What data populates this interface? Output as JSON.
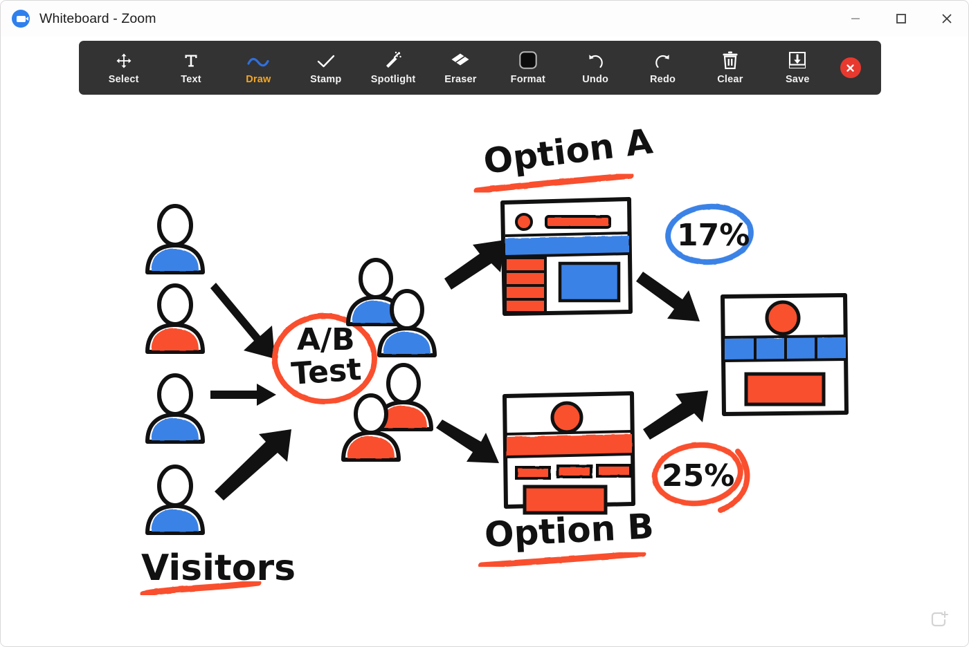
{
  "window": {
    "title": "Whiteboard - Zoom",
    "logo_icon": "zoom-camera-icon",
    "controls": [
      {
        "name": "minimize",
        "icon": "minimize-icon"
      },
      {
        "name": "maximize",
        "icon": "maximize-icon"
      },
      {
        "name": "close",
        "icon": "close-icon"
      }
    ]
  },
  "toolbar": {
    "active_tool": "Draw",
    "tools": [
      {
        "label": "Select",
        "icon": "move-arrows-icon"
      },
      {
        "label": "Text",
        "icon": "text-t-icon"
      },
      {
        "label": "Draw",
        "icon": "squiggle-line-icon"
      },
      {
        "label": "Stamp",
        "icon": "checkmark-icon"
      },
      {
        "label": "Spotlight",
        "icon": "magic-wand-icon"
      },
      {
        "label": "Eraser",
        "icon": "eraser-icon"
      },
      {
        "label": "Format",
        "icon": "format-square-icon"
      },
      {
        "label": "Undo",
        "icon": "undo-arrow-icon"
      },
      {
        "label": "Redo",
        "icon": "redo-arrow-icon"
      },
      {
        "label": "Clear",
        "icon": "trash-bin-icon"
      },
      {
        "label": "Save",
        "icon": "download-tray-icon"
      }
    ],
    "close_button": {
      "icon": "close-x-icon",
      "color": "#e8392e"
    }
  },
  "canvas": {
    "add_page_button": {
      "icon": "add-page-icon"
    },
    "drawing": {
      "title": "A/B Test funnel sketch",
      "labels": {
        "visitors": "Visitors",
        "ab_test": {
          "line1": "A/B",
          "line2": "Test"
        },
        "option_a": "Option A",
        "option_b": "Option B",
        "metric_a": "17%",
        "metric_b": "25%"
      },
      "colors": {
        "ink": "#111111",
        "blue": "#3b82e6",
        "red": "#f9502e"
      },
      "visitor_avatars": [
        {
          "shirt": "blue"
        },
        {
          "shirt": "red"
        },
        {
          "shirt": "blue"
        },
        {
          "shirt": "blue"
        }
      ],
      "branch_a_avatars": [
        {
          "shirt": "blue"
        },
        {
          "shirt": "blue"
        }
      ],
      "branch_b_avatars": [
        {
          "shirt": "red"
        },
        {
          "shirt": "red"
        }
      ],
      "wireframe_a": {
        "name": "option-a-wireframe",
        "header_dot": "red",
        "header_bar": "red",
        "nav_band": "blue",
        "sidebar_rows": "red",
        "content_box": "blue"
      },
      "wireframe_b": {
        "name": "option-b-wireframe",
        "header_dot": "red",
        "nav_band": "red",
        "small_bars": "red",
        "content_box": "red"
      },
      "wireframe_result": {
        "name": "result-wireframe",
        "header_dot": "red",
        "nav_segments": "blue",
        "nav_segment_count": 4,
        "content_box": "red"
      },
      "metric_a_circle_color": "blue",
      "metric_b_circle_color": "red"
    }
  }
}
